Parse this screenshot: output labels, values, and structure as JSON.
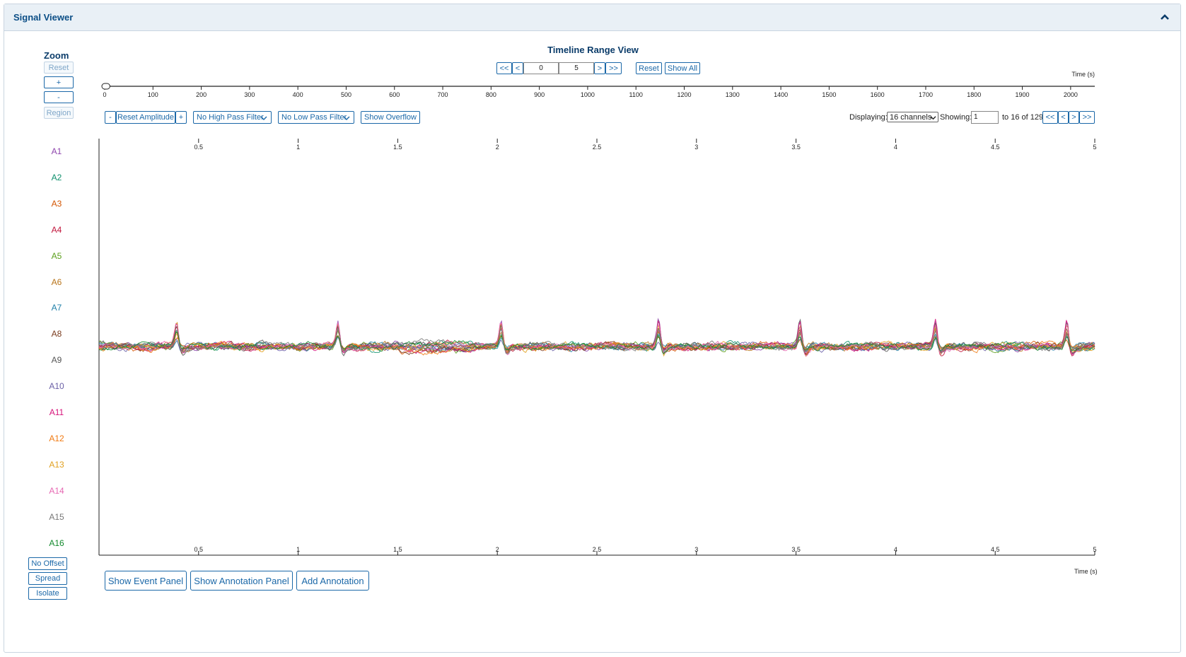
{
  "panel": {
    "title": "Signal Viewer"
  },
  "zoom": {
    "title": "Zoom",
    "reset": "Reset",
    "plus": "+",
    "minus": "-",
    "region": "Region"
  },
  "timeline": {
    "title": "Timeline Range View",
    "first": "<<",
    "prev": "<",
    "start_value": "0",
    "end_value": "5",
    "next": ">",
    "last": ">>",
    "reset": "Reset",
    "show_all": "Show All",
    "axis_label": "Time (s)",
    "ticks": [
      "0",
      "100",
      "200",
      "300",
      "400",
      "500",
      "600",
      "700",
      "800",
      "900",
      "1000",
      "1100",
      "1200",
      "1300",
      "1400",
      "1500",
      "1600",
      "1700",
      "1800",
      "1900",
      "2000"
    ]
  },
  "controls": {
    "amp_minus": "-",
    "reset_amplitude": "Reset Amplitude",
    "amp_plus": "+",
    "high_pass": "No High Pass Filter",
    "low_pass": "No Low Pass Filter",
    "show_overflow": "Show Overflow",
    "displaying_label": "Displaying:",
    "channels_select": "16 channels",
    "showing_label": "Showing:",
    "showing_value": "1",
    "range_text": "to 16 of 129",
    "first": "<<",
    "prev": "<",
    "next": ">",
    "last": ">>"
  },
  "channels": [
    {
      "name": "A1",
      "color": "#8e44ad"
    },
    {
      "name": "A2",
      "color": "#0e8f6c"
    },
    {
      "name": "A3",
      "color": "#d35400"
    },
    {
      "name": "A4",
      "color": "#c0133a"
    },
    {
      "name": "A5",
      "color": "#5a9e1a"
    },
    {
      "name": "A6",
      "color": "#b8741a"
    },
    {
      "name": "A7",
      "color": "#1f7fa8"
    },
    {
      "name": "A8",
      "color": "#7a3b1e"
    },
    {
      "name": "A9",
      "color": "#555555"
    },
    {
      "name": "A10",
      "color": "#6a5fa6"
    },
    {
      "name": "A11",
      "color": "#d6127a"
    },
    {
      "name": "A12",
      "color": "#f07a12"
    },
    {
      "name": "A13",
      "color": "#e0a020"
    },
    {
      "name": "A14",
      "color": "#e667b2"
    },
    {
      "name": "A15",
      "color": "#777777"
    },
    {
      "name": "A16",
      "color": "#128a2c"
    }
  ],
  "signal_axis": {
    "ticks": [
      "0.5",
      "1",
      "1.5",
      "2",
      "2.5",
      "3",
      "3.5",
      "4",
      "4.5",
      "5"
    ],
    "axis_label": "Time (s)"
  },
  "spikes": [
    0.39,
    1.2,
    2.02,
    2.81,
    3.52,
    4.2,
    4.86
  ],
  "left_buttons": {
    "no_offset": "No Offset",
    "spread": "Spread",
    "isolate": "Isolate"
  },
  "bottom_buttons": {
    "event_panel": "Show Event Panel",
    "annotation_panel": "Show Annotation Panel",
    "add_annotation": "Add Annotation"
  },
  "colors": {
    "accent": "#1b68a8",
    "title": "#0b4e86",
    "header_bg": "#e9f0f6"
  }
}
